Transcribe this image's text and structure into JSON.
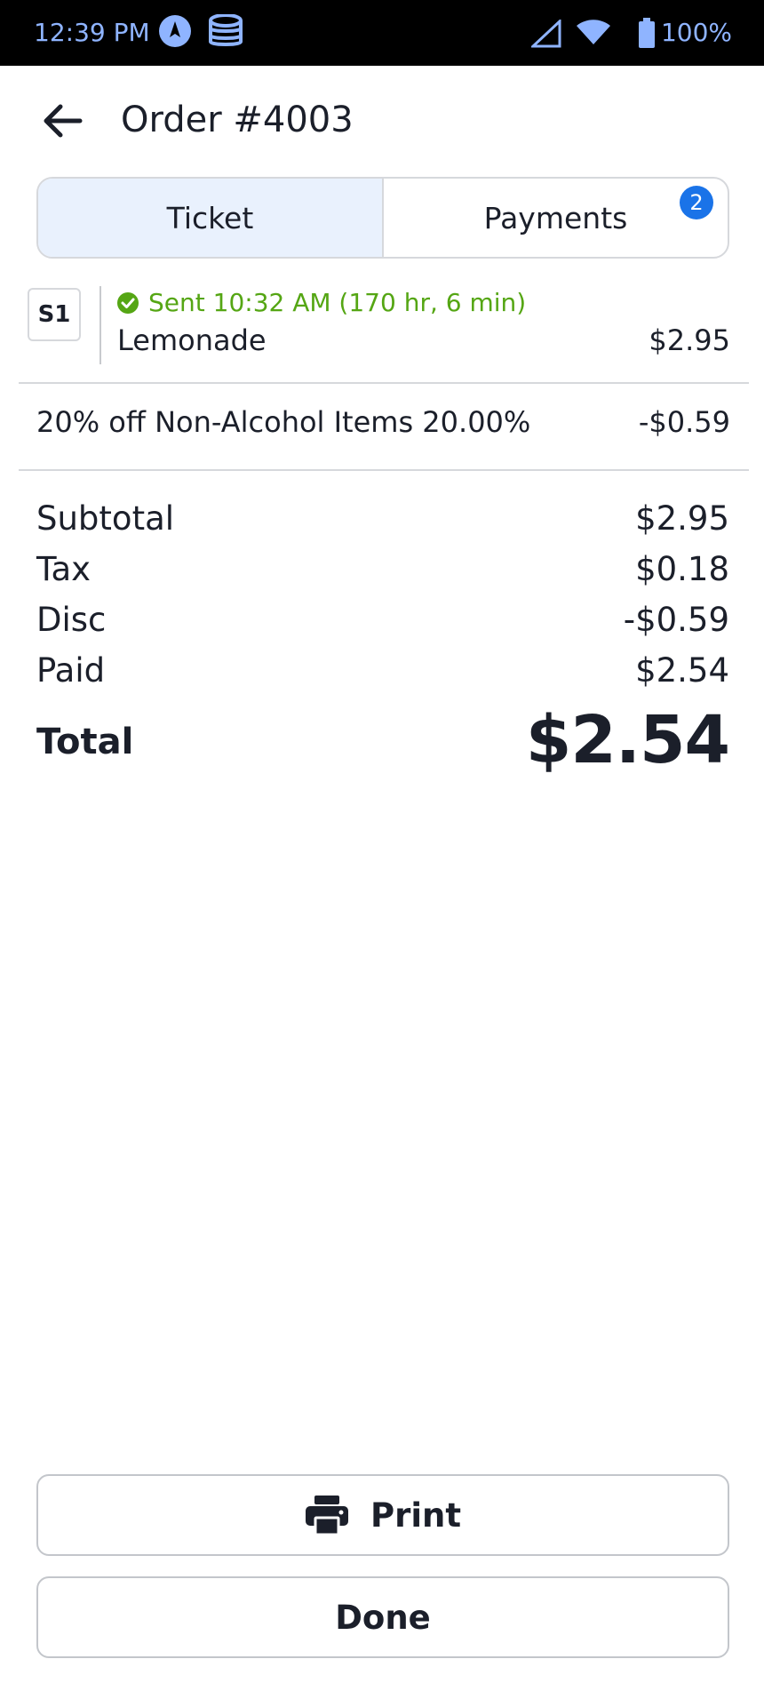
{
  "status_bar": {
    "time": "12:39 PM",
    "battery": "100%",
    "icons": [
      "navigation-icon",
      "database-icon",
      "signal-icon",
      "wifi-icon",
      "battery-icon"
    ]
  },
  "header": {
    "title": "Order #4003"
  },
  "tabs": [
    {
      "label": "Ticket",
      "active": true
    },
    {
      "label": "Payments",
      "badge": "2"
    }
  ],
  "item": {
    "seat": "S1",
    "status": "Sent 10:32 AM (170 hr, 6 min)",
    "name": "Lemonade",
    "price": "$2.95"
  },
  "discount": {
    "label": "20% off Non-Alcohol Items 20.00%",
    "amount": "-$0.59"
  },
  "summary": [
    {
      "label": "Subtotal",
      "value": "$2.95"
    },
    {
      "label": "Tax",
      "value": "$0.18"
    },
    {
      "label": "Disc",
      "value": "-$0.59"
    },
    {
      "label": "Paid",
      "value": "$2.54"
    }
  ],
  "total": {
    "label": "Total",
    "value": "$2.54"
  },
  "buttons": {
    "print": "Print",
    "done": "Done"
  },
  "colors": {
    "accent": "#1a73e8",
    "sent": "#55a614",
    "tab_active": "#e9f1fd"
  }
}
